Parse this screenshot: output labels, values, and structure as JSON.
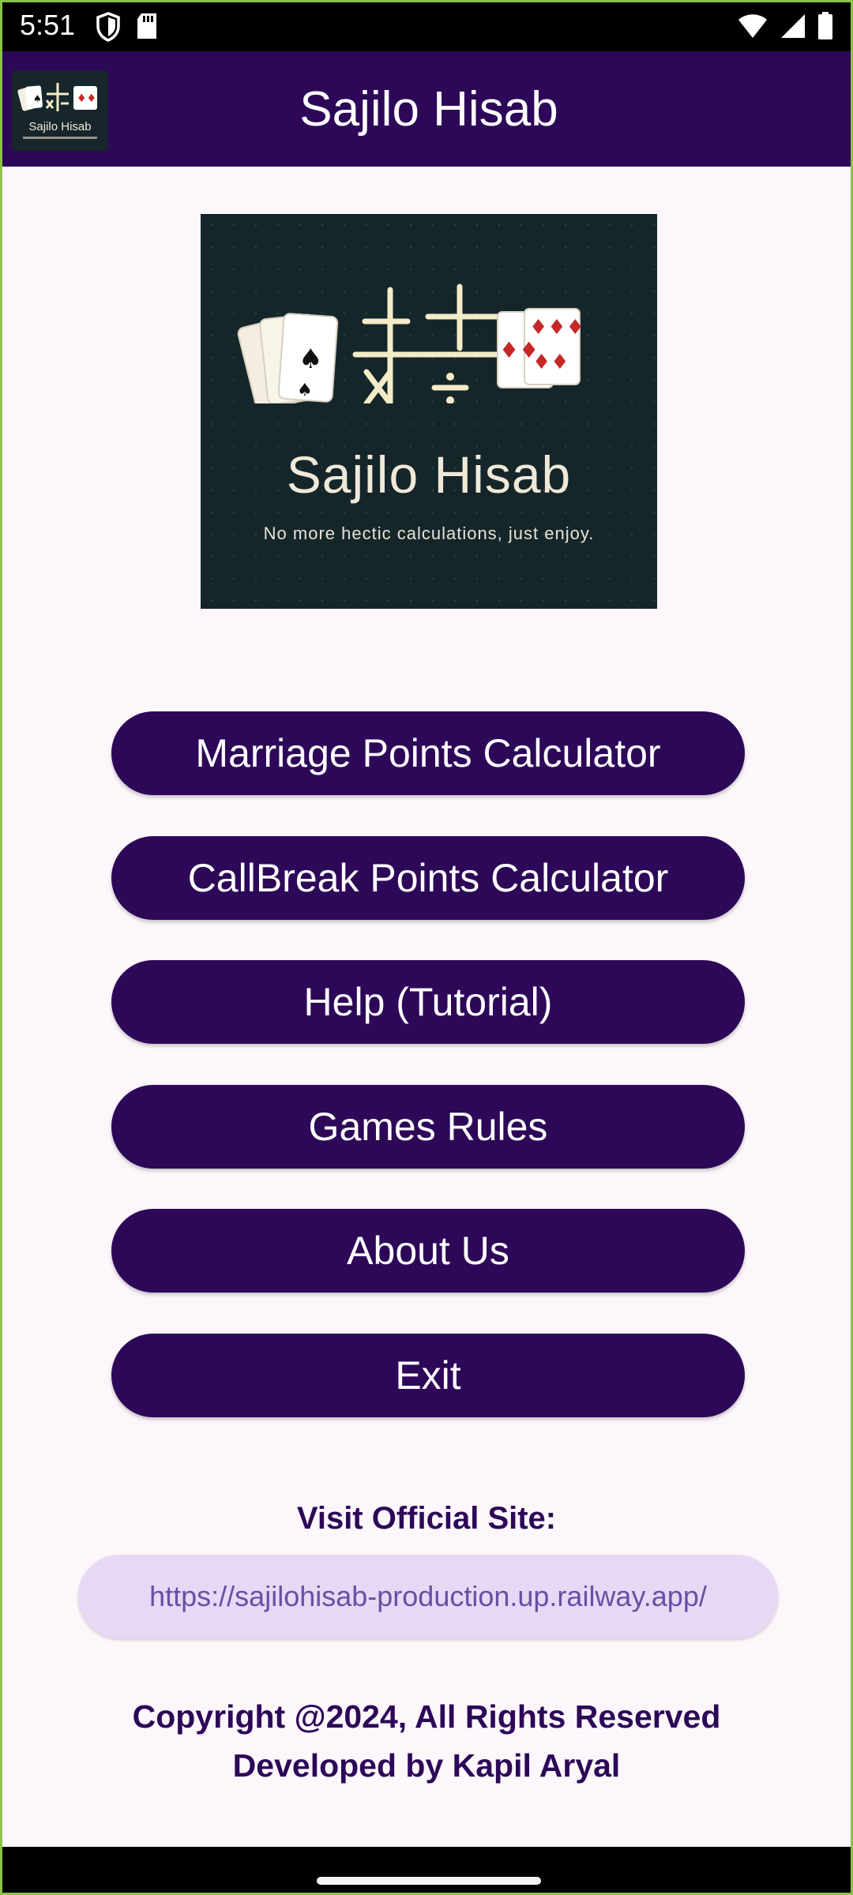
{
  "status_bar": {
    "time": "5:51",
    "left_icons": [
      "shield-icon",
      "sd-card-icon"
    ],
    "right_icons": [
      "wifi-icon",
      "signal-icon",
      "battery-icon"
    ]
  },
  "app_bar": {
    "title": "Sajilo Hisab",
    "logo_text": "Sajilo Hisab",
    "color": "#2d0858"
  },
  "banner": {
    "title": "Sajilo Hisab",
    "tagline": "No more hectic calculations, just enjoy."
  },
  "menu": {
    "marriage": "Marriage Points Calculator",
    "callbreak": "CallBreak Points Calculator",
    "help": "Help (Tutorial)",
    "rules": "Games Rules",
    "about": "About Us",
    "exit": "Exit"
  },
  "site": {
    "label": "Visit Official Site:",
    "url": "https://sajilohisab-production.up.railway.app/"
  },
  "footer": {
    "copyright": "Copyright @2024, All Rights Reserved",
    "developer": "Developed by Kapil Aryal"
  },
  "colors": {
    "primary": "#2d0858",
    "background": "#fdf7fc",
    "link_bg": "#e7d8f5",
    "link_text": "#6750a4"
  }
}
